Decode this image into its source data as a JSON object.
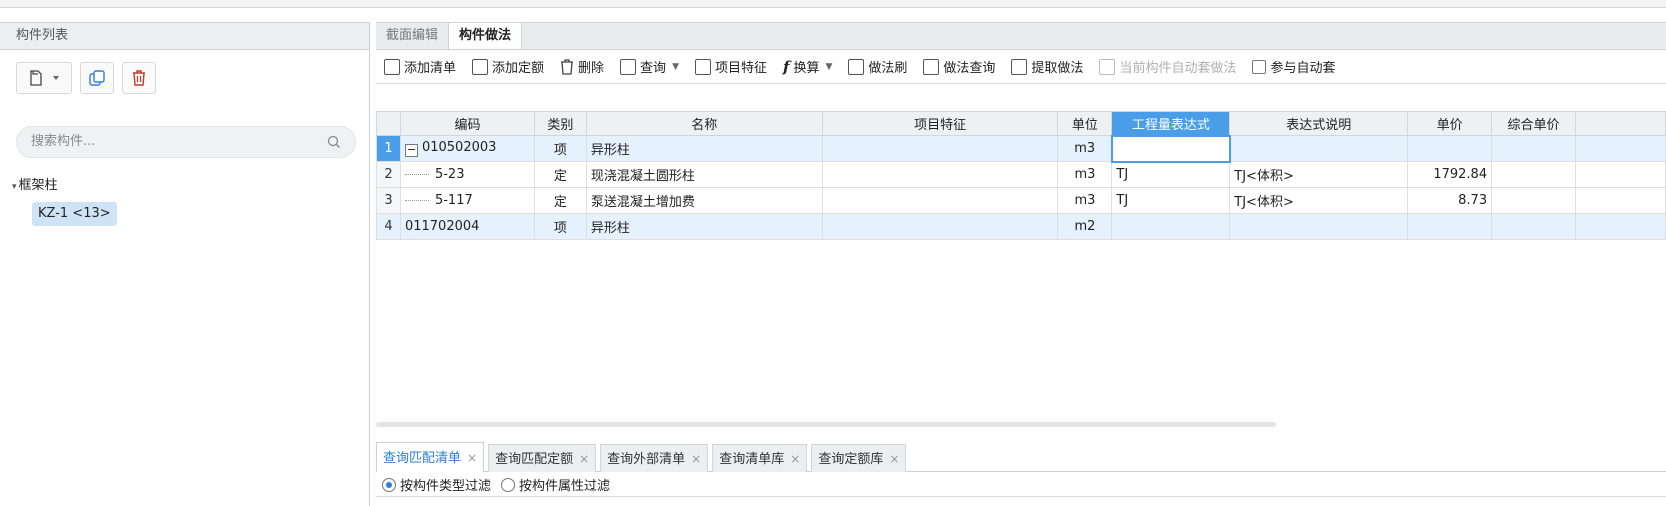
{
  "left_panel": {
    "title": "构件列表",
    "search_placeholder": "搜索构件...",
    "tree_group": "框架柱",
    "tree_item": "KZ-1 <13>"
  },
  "top_tabs": [
    {
      "label": "截面编辑",
      "active": false
    },
    {
      "label": "构件做法",
      "active": true
    }
  ],
  "toolbar": {
    "add_list": "添加清单",
    "add_quota": "添加定额",
    "delete": "删除",
    "query": "查询",
    "item_feature": "项目特征",
    "convert": "换算",
    "method_brush": "做法刷",
    "method_query": "做法查询",
    "extract_method": "提取做法",
    "auto_apply_current": "当前构件自动套做法",
    "join_auto_apply": "参与自动套"
  },
  "grid": {
    "columns": [
      "编码",
      "类别",
      "名称",
      "项目特征",
      "单位",
      "工程量表达式",
      "表达式说明",
      "单价",
      "综合单价"
    ],
    "rows": [
      {
        "n": "1",
        "code": "010502003",
        "type": "项",
        "name": "异形柱",
        "feature": "",
        "unit": "m3",
        "expr": "",
        "desc": "",
        "price": "",
        "total": ""
      },
      {
        "n": "2",
        "code": "5-23",
        "type": "定",
        "name": "现浇混凝土圆形柱",
        "feature": "",
        "unit": "m3",
        "expr": "TJ",
        "desc": "TJ<体积>",
        "price": "1792.84",
        "total": ""
      },
      {
        "n": "3",
        "code": "5-117",
        "type": "定",
        "name": "泵送混凝土增加费",
        "feature": "",
        "unit": "m3",
        "expr": "TJ",
        "desc": "TJ<体积>",
        "price": "8.73",
        "total": ""
      },
      {
        "n": "4",
        "code": "011702004",
        "type": "项",
        "name": "异形柱",
        "feature": "",
        "unit": "m2",
        "expr": "",
        "desc": "",
        "price": "",
        "total": ""
      }
    ]
  },
  "bottom_tabs": [
    "查询匹配清单",
    "查询匹配定额",
    "查询外部清单",
    "查询清单库",
    "查询定额库"
  ],
  "filters": {
    "by_type": "按构件类型过滤",
    "by_attr": "按构件属性过滤"
  },
  "colors": {
    "accent": "#4a9ee8",
    "selected_row": "#e5f1fc",
    "tab_active_text": "#2b7fd6"
  }
}
